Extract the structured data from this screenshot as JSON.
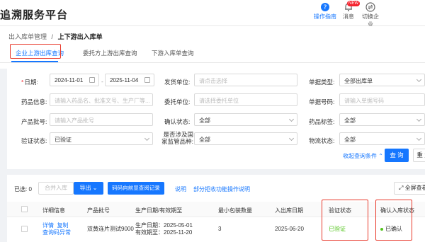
{
  "app": {
    "title": "追溯服务平台"
  },
  "topbar": {
    "guide_label": "操作指南",
    "msg_label": "消息",
    "msg_badge": "NEW",
    "switch_label": "切换企业"
  },
  "breadcrumb": {
    "parent": "出入库单管理",
    "sep": "/",
    "current": "上下游出入库单"
  },
  "tabs": [
    {
      "label": "企业上游出库查询",
      "active": true
    },
    {
      "label": "委托方上游出库查询",
      "active": false
    },
    {
      "label": "下游入库单查询",
      "active": false
    }
  ],
  "filters": {
    "date_label": "日期:",
    "date_start": "2024-11-01",
    "date_end": "2025-11-04",
    "sender_label": "发货单位:",
    "sender_placeholder": "请点击选择",
    "doc_type_label": "单据类型:",
    "doc_type_value": "全部出库单",
    "drug_info_label": "药品信息:",
    "drug_info_placeholder": "请输入药品名、批准文号、生产厂等...",
    "entrust_label": "委托单位:",
    "entrust_placeholder": "请选择委托单位",
    "doc_no_label": "单据号码:",
    "doc_no_placeholder": "请输入单据号码",
    "batch_label": "产品批号:",
    "batch_placeholder": "请输入产品批号",
    "confirm_label": "确认状态:",
    "confirm_value": "全部",
    "drug_tag_label": "药品标签:",
    "drug_tag_value": "全部",
    "verify_label": "验证状态:",
    "verify_value": "已验证",
    "supervise_label": "是否涉及国家监管品种:",
    "supervise_value": "全部",
    "logistics_label": "物流状态:",
    "logistics_value": "全部",
    "collapse_label": "收起查询条件",
    "query_button": "查 询",
    "reset_button": "重 置"
  },
  "toolbar": {
    "selected_label": "已选:",
    "selected_count": "0",
    "merge_button": "合并入库",
    "export_button": "导出",
    "browse_button": "码码向前显查阅记录",
    "explain_link": "说明",
    "partial_link": "部分拒收功能操作说明",
    "fullscreen_button": "全屏查看"
  },
  "table": {
    "headers": [
      "详细信息",
      "产品批号",
      "生产日期/有效期至",
      "最小包装数量",
      "入出库日期",
      "验证状态",
      "确认入库状态"
    ],
    "rows": [
      {
        "actions": [
          "详情",
          "复制",
          "查询码异常"
        ],
        "batch": "双黄连片测试9000",
        "prod_date": "生产日期：2025-05-01",
        "exp_date": "有效期至：2025-11-20",
        "min_qty": "3",
        "io_date": "2025-06-20",
        "verify_status": "已验证",
        "confirm_status": "已确认"
      }
    ]
  },
  "colors": {
    "accent": "#1677ff",
    "highlight": "#e8392b",
    "success": "#52c41a"
  }
}
